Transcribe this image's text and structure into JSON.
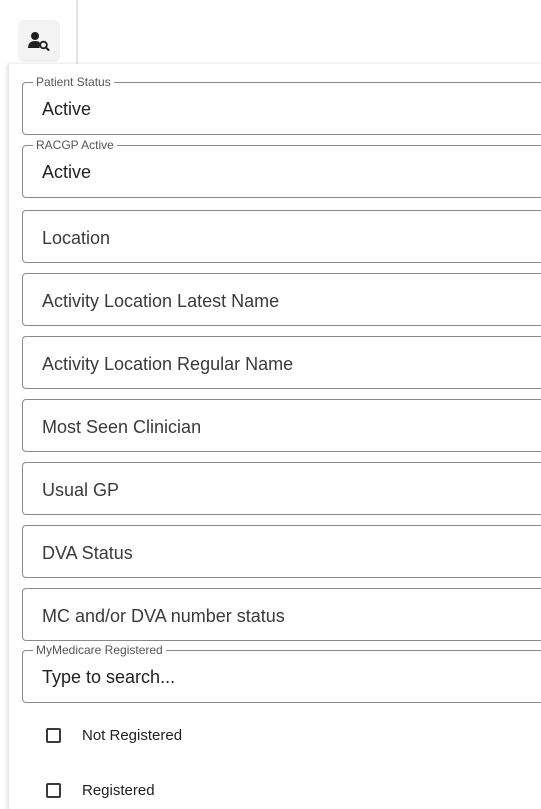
{
  "toolbar": {
    "icon": "person-search-icon"
  },
  "filters": {
    "patient_status": {
      "label": "Patient Status",
      "value": "Active"
    },
    "racgp_active": {
      "label": "RACGP Active",
      "value": "Active"
    },
    "location": {
      "placeholder": "Location"
    },
    "activity_location_latest_name": {
      "placeholder": "Activity Location Latest Name"
    },
    "activity_location_regular_name": {
      "placeholder": "Activity Location Regular Name"
    },
    "most_seen_clinician": {
      "placeholder": "Most Seen Clinician"
    },
    "usual_gp": {
      "placeholder": "Usual GP"
    },
    "dva_status": {
      "placeholder": "DVA Status"
    },
    "mc_dva_number_status": {
      "placeholder": "MC and/or DVA number status"
    },
    "mymedicare_registered": {
      "label": "MyMedicare Registered",
      "placeholder": "Type to search...",
      "options": [
        {
          "label": "Not Registered",
          "checked": false
        },
        {
          "label": "Registered",
          "checked": false
        }
      ]
    }
  }
}
